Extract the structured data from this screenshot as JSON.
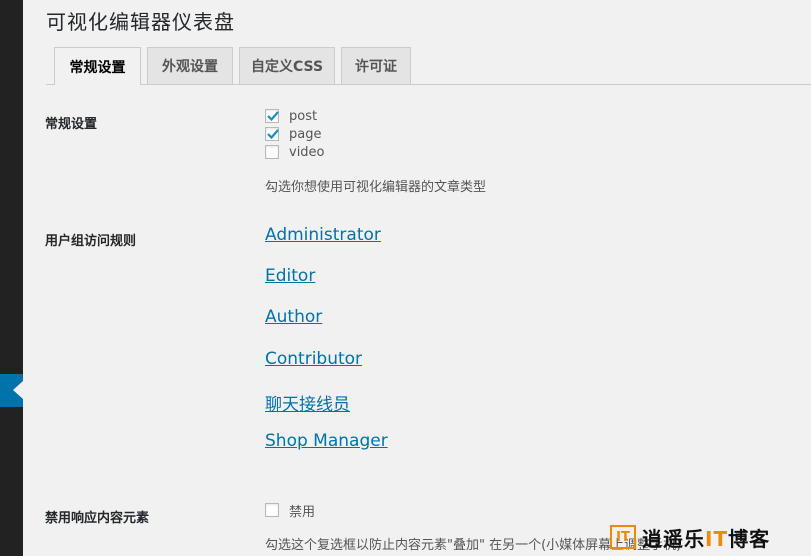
{
  "page": {
    "title": "可视化编辑器仪表盘"
  },
  "tabs": [
    {
      "label": "常规设置",
      "active": true
    },
    {
      "label": "外观设置",
      "active": false
    },
    {
      "label": "自定义CSS",
      "active": false
    },
    {
      "label": "许可证",
      "active": false
    }
  ],
  "general": {
    "label": "常规设置",
    "post_types": [
      {
        "label": "post",
        "checked": true
      },
      {
        "label": "page",
        "checked": true
      },
      {
        "label": "video",
        "checked": false
      }
    ],
    "description": "勾选你想使用可视化编辑器的文章类型"
  },
  "roles": {
    "label": "用户组访问规则",
    "items": [
      "Administrator",
      "Editor",
      "Author",
      "Contributor",
      "聊天接线员",
      "Shop Manager"
    ]
  },
  "responsive": {
    "label": "禁用响应内容元素",
    "checkbox_label": "禁用",
    "checked": false,
    "description": "勾选这个复选框以防止内容元素\"叠加\" 在另一个(小媒体屏幕上调整手机)"
  },
  "watermark": {
    "logo": "IT",
    "text_a": "逍遥乐",
    "text_b": "IT",
    "text_c": "博客"
  },
  "colors": {
    "accent": "#0073aa",
    "sidebar": "#222222",
    "background": "#f1f1f1"
  }
}
